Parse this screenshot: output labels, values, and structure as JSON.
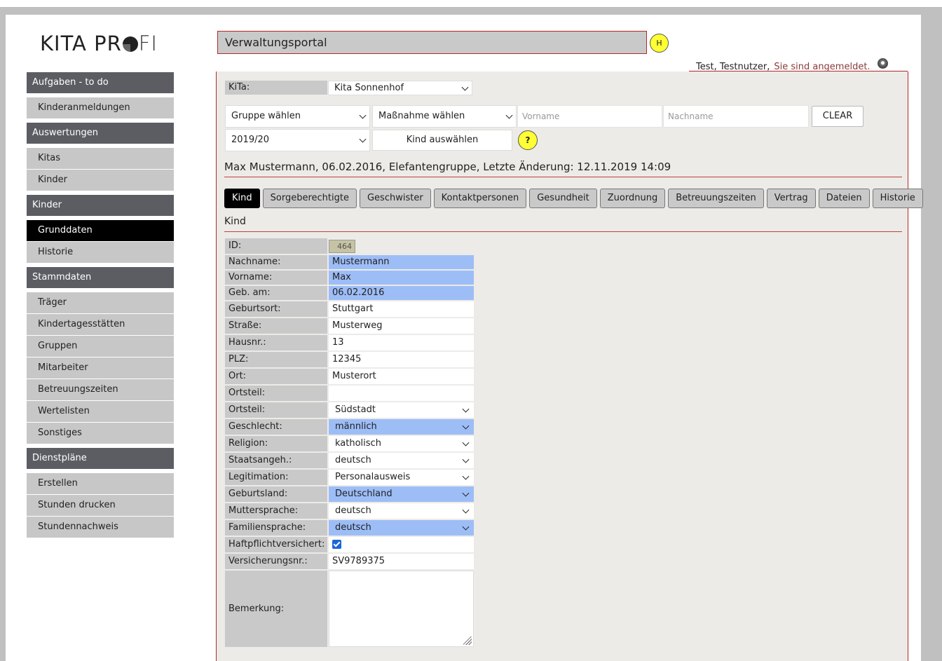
{
  "app": {
    "logo_left": "KITA PR",
    "logo_right": "FI",
    "portal_title": "Verwaltungsportal",
    "help_label": "H"
  },
  "user": {
    "name": "Test, Testnutzer,",
    "status": "Sie sind angemeldet."
  },
  "sidebar": {
    "groups": [
      {
        "head": "Aufgaben - to do",
        "items": [
          "Kinderanmeldungen"
        ]
      },
      {
        "head": "Auswertungen",
        "items": [
          "Kitas",
          "Kinder"
        ]
      },
      {
        "head": "Kinder",
        "items": [
          "Grunddaten",
          "Historie"
        ]
      },
      {
        "head": "Stammdaten",
        "items": [
          "Träger",
          "Kindertagesstätten",
          "Gruppen",
          "Mitarbeiter",
          "Betreuungszeiten",
          "Wertelisten",
          "Sonstiges"
        ]
      },
      {
        "head": "Dienstpläne",
        "items": [
          "Erstellen",
          "Stunden drucken",
          "Stundennachweis"
        ]
      }
    ],
    "active_item": "Grunddaten"
  },
  "filters": {
    "kita_label": "KiTa:",
    "kita_value": "Kita Sonnenhof",
    "gruppe_value": "Gruppe wählen",
    "massnahme_value": "Maßnahme wählen",
    "vorname_placeholder": "Vorname",
    "nachname_placeholder": "Nachname",
    "clear_label": "CLEAR",
    "jahr_value": "2019/20",
    "kind_button": "Kind auswählen",
    "help_q": "?"
  },
  "kid_title": "Max Mustermann, 06.02.2016, Elefantengruppe, Letzte Änderung: 12.11.2019 14:09",
  "tabs": [
    "Kind",
    "Sorgeberechtigte",
    "Geschwister",
    "Kontaktpersonen",
    "Gesundheit",
    "Zuordnung",
    "Betreuungszeiten",
    "Vertrag",
    "Dateien",
    "Historie"
  ],
  "active_tab": "Kind",
  "section_title": "Kind",
  "form": {
    "id_label": "ID:",
    "id_value": "464",
    "fields": [
      {
        "label": "Nachname:",
        "value": "Mustermann",
        "type": "text",
        "highlight": true
      },
      {
        "label": "Vorname:",
        "value": "Max",
        "type": "text",
        "highlight": true
      },
      {
        "label": "Geb. am:",
        "value": "06.02.2016",
        "type": "text",
        "highlight": true
      },
      {
        "label": "Geburtsort:",
        "value": "Stuttgart",
        "type": "text",
        "highlight": false
      },
      {
        "label": "Straße:",
        "value": "Musterweg",
        "type": "text",
        "highlight": false
      },
      {
        "label": "Hausnr.:",
        "value": "13",
        "type": "text",
        "highlight": false
      },
      {
        "label": "PLZ:",
        "value": "12345",
        "type": "text",
        "highlight": false
      },
      {
        "label": "Ort:",
        "value": "Musterort",
        "type": "text",
        "highlight": false
      },
      {
        "label": "Ortsteil:",
        "value": "",
        "type": "text",
        "highlight": false
      },
      {
        "label": "Ortsteil:",
        "value": "Südstadt",
        "type": "select",
        "highlight": false
      },
      {
        "label": "Geschlecht:",
        "value": "männlich",
        "type": "select",
        "highlight": true
      },
      {
        "label": "Religion:",
        "value": "katholisch",
        "type": "select",
        "highlight": false
      },
      {
        "label": "Staatsangeh.:",
        "value": "deutsch",
        "type": "select",
        "highlight": false
      },
      {
        "label": "Legitimation:",
        "value": "Personalausweis",
        "type": "select",
        "highlight": false
      },
      {
        "label": "Geburtsland:",
        "value": "Deutschland",
        "type": "select",
        "highlight": true
      },
      {
        "label": "Muttersprache:",
        "value": "deutsch",
        "type": "select",
        "highlight": false
      },
      {
        "label": "Familiensprache:",
        "value": "deutsch",
        "type": "select",
        "highlight": true
      },
      {
        "label": "Haftpflichtversichert:",
        "value": "",
        "type": "checkbox",
        "checked": true,
        "highlight": false
      },
      {
        "label": "Versicherungsnr.:",
        "value": "SV9789375",
        "type": "text",
        "highlight": false
      }
    ],
    "bemerkung_label": "Bemerkung:"
  },
  "colors": {
    "accent_red": "#b02a2a",
    "highlight_blue": "#9dbdf7",
    "sidebar_head": "#5b5d63",
    "help_yellow": "#ffff33"
  }
}
